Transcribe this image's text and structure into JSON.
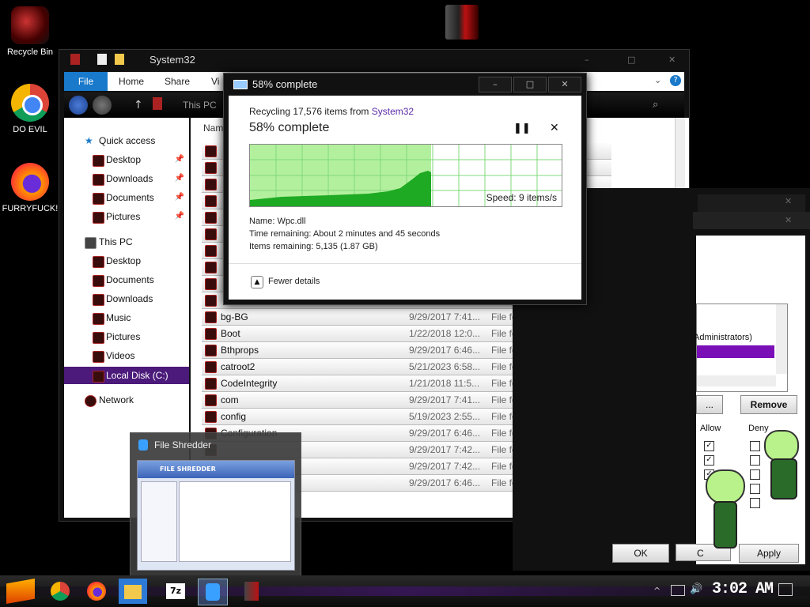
{
  "desktop": {
    "icons": [
      {
        "label": "Recycle Bin"
      },
      {
        "label": "DO EVIL"
      },
      {
        "label": "FURRYFUCK!"
      }
    ]
  },
  "explorer": {
    "title": "System32",
    "ribbon": {
      "file": "File",
      "home": "Home",
      "share": "Share",
      "view": "Vi"
    },
    "address": [
      "This PC"
    ],
    "column_name": "Name",
    "sidebar": {
      "quick_access": "Quick access",
      "quick_items": [
        "Desktop",
        "Downloads",
        "Documents",
        "Pictures"
      ],
      "this_pc": "This PC",
      "pc_items": [
        "Desktop",
        "Documents",
        "Downloads",
        "Music",
        "Pictures",
        "Videos"
      ],
      "local_disk": "Local Disk (C:)",
      "network": "Network"
    },
    "rows": [
      {
        "name": "bg-BG",
        "date": "9/29/2017 7:41...",
        "type": "File folder"
      },
      {
        "name": "Boot",
        "date": "1/22/2018 12:0...",
        "type": "File folder"
      },
      {
        "name": "Bthprops",
        "date": "9/29/2017 6:46...",
        "type": "File folder"
      },
      {
        "name": "catroot2",
        "date": "5/21/2023 6:58...",
        "type": "File folder"
      },
      {
        "name": "CodeIntegrity",
        "date": "1/21/2018 11:5...",
        "type": "File folder"
      },
      {
        "name": "com",
        "date": "9/29/2017 7:41...",
        "type": "File folder"
      },
      {
        "name": "config",
        "date": "5/19/2023 2:55...",
        "type": "File folder"
      },
      {
        "name": "Configuration",
        "date": "9/29/2017 6:46...",
        "type": "File folder"
      },
      {
        "name": "",
        "date": "9/29/2017 7:42...",
        "type": "File folder"
      },
      {
        "name": "",
        "date": "9/29/2017 7:42...",
        "type": "File folder"
      },
      {
        "name": "",
        "date": "9/29/2017 6:46...",
        "type": "File folder"
      }
    ]
  },
  "progress": {
    "title": "58% complete",
    "recycling_prefix": "Recycling 17,576 items from ",
    "recycling_source": "System32",
    "heading": "58% complete",
    "percent": 58,
    "speed": "Speed: 9 items/s",
    "name": "Name:  Wpc.dll",
    "time_remaining": "Time remaining:  About 2 minutes and 45 seconds",
    "items_remaining": "Items remaining:  5,135 (1.87 GB)",
    "fewer_details": "Fewer details",
    "window_buttons": [
      "–",
      "□",
      "✕"
    ]
  },
  "security": {
    "group_text": "Administrators)",
    "remove": "Remove",
    "allow": "Allow",
    "deny": "Deny",
    "ok": "OK",
    "apply": "Apply",
    "cancel_partial": "C"
  },
  "shredder": {
    "title": "File Shredder",
    "banner": "FILE SHREDDER"
  },
  "taskbar": {
    "clock": "3:02 AM",
    "accent": "#7b2fd0"
  }
}
